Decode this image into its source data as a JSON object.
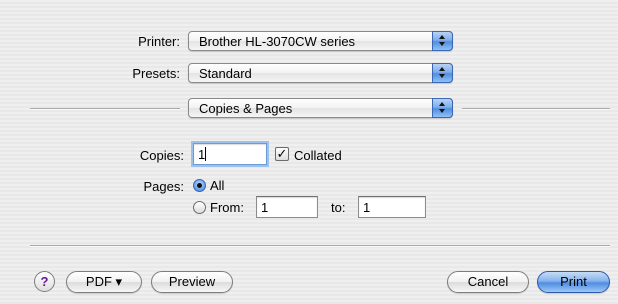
{
  "printer": {
    "label": "Printer:",
    "value": "Brother HL-3070CW series"
  },
  "presets": {
    "label": "Presets:",
    "value": "Standard"
  },
  "panel_menu": {
    "value": "Copies & Pages"
  },
  "copies": {
    "label": "Copies:",
    "value": "1",
    "collated_label": "Collated",
    "collated_checked": true
  },
  "pages": {
    "label": "Pages:",
    "all_label": "All",
    "from_label": "From:",
    "from_value": "1",
    "to_label": "to:",
    "to_value": "1",
    "selected": "all"
  },
  "footer": {
    "help_label": "?",
    "pdf_label": "PDF ▾",
    "preview_label": "Preview",
    "cancel_label": "Cancel",
    "print_label": "Print"
  },
  "colors": {
    "accent": "#5a95e6",
    "background": "#ececec",
    "help_glyph": "#6a1aa0"
  }
}
